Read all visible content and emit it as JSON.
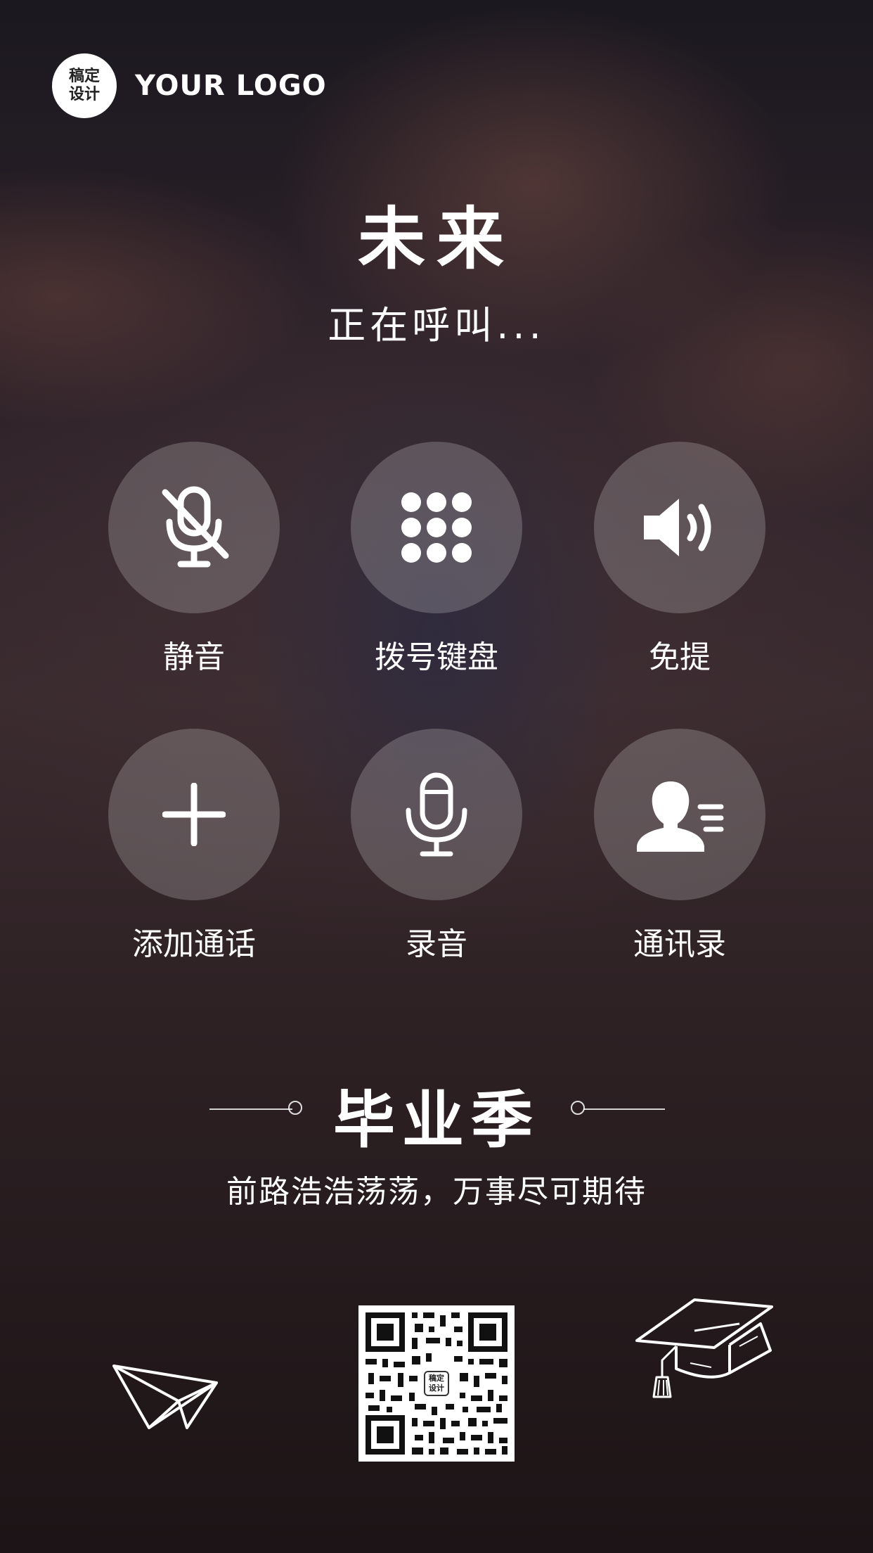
{
  "brand": {
    "logo_badge_line1": "稿定",
    "logo_badge_line2": "设计",
    "logo_text": "YOUR LOGO"
  },
  "call": {
    "caller_name": "未来",
    "status": "正在呼叫..."
  },
  "controls": [
    {
      "label": "静音",
      "icon": "mute-mic-icon"
    },
    {
      "label": "拨号键盘",
      "icon": "keypad-icon"
    },
    {
      "label": "免提",
      "icon": "speaker-icon"
    },
    {
      "label": "添加通话",
      "icon": "plus-icon"
    },
    {
      "label": "录音",
      "icon": "microphone-icon"
    },
    {
      "label": "通讯录",
      "icon": "contacts-icon"
    }
  ],
  "promo": {
    "title": "毕业季",
    "slogan": "前路浩浩荡荡，万事尽可期待",
    "qr_badge_line1": "稿定",
    "qr_badge_line2": "设计"
  },
  "decorations": [
    "paper-plane-icon",
    "graduation-cap-icon"
  ],
  "colors": {
    "text": "#ffffff",
    "button_fill": "rgba(255,255,255,0.20)",
    "background_dark": "#1c1416"
  }
}
